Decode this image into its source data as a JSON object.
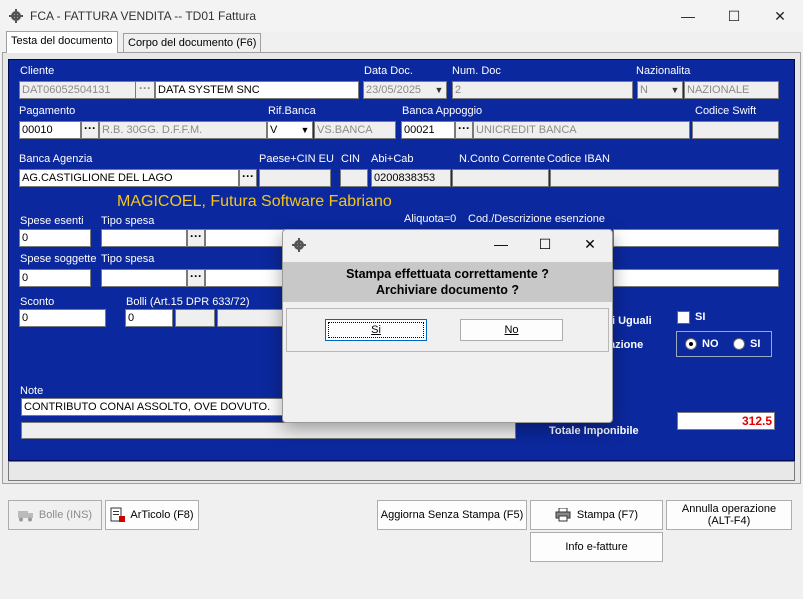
{
  "window": {
    "title": "FCA - FATTURA VENDITA  --  TD01 Fattura",
    "minimize": "—",
    "maximize": "☐",
    "close": "✕"
  },
  "tabs": [
    {
      "label": "Testa del documento"
    },
    {
      "label": "Corpo del documento (F6)"
    }
  ],
  "header": {
    "cliente_label": "Cliente",
    "cliente_code": "DAT06052504131",
    "cliente_name": "DATA SYSTEM SNC",
    "data_doc_label": "Data Doc.",
    "data_doc": "23/05/2025",
    "num_doc_label": "Num. Doc",
    "num_doc": "2",
    "nazionalita_label": "Nazionalita",
    "nazionalita_code": "N",
    "nazionalita_name": "NAZIONALE"
  },
  "pagamento": {
    "label": "Pagamento",
    "code": "00010",
    "desc": "R.B. 30GG. D.F.F.M.",
    "rif_banca_label": "Rif.Banca",
    "rif_banca_code": "V",
    "rif_banca_desc": "VS.BANCA",
    "banca_appoggio_label": "Banca Appoggio",
    "banca_appoggio_code": "00021",
    "banca_appoggio_name": "UNICREDIT BANCA",
    "codice_swift_label": "Codice Swift"
  },
  "banca_agenzia": {
    "label": "Banca Agenzia",
    "value": "AG.CASTIGLIONE DEL LAGO",
    "paese_cin_label": "Paese+CIN EU",
    "cin_label": "CIN",
    "abi_cab_label": "Abi+Cab",
    "abi_cab": "0200838353",
    "n_conto_label": "N.Conto Corrente",
    "iban_label": "Codice IBAN"
  },
  "brand": "MAGICOEL, Futura Software Fabriano",
  "spese": {
    "esenti_label": "Spese esenti",
    "esenti_value": "0",
    "tipo_spesa_label": "Tipo spesa",
    "aliquota_label": "Aliquota=0",
    "cod_desc_label": "Cod./Descrizione esenzione",
    "soggette_label": "Spese soggette",
    "soggette_value": "0",
    "tipo_spesa2_label": "Tipo spesa"
  },
  "sconto": {
    "label": "Sconto",
    "value": "0",
    "bolli_label": "Bolli (Art.15 DPR 633/72)",
    "bolli_value": "0"
  },
  "options": {
    "uguali_label": "i Uguali",
    "si_label": "SI",
    "azione_label": "azione",
    "no_radio": "NO",
    "si_radio": "SI"
  },
  "note": {
    "label": "Note",
    "value": "CONTRIBUTO CONAI ASSOLTO, OVE DOVUTO."
  },
  "totale": {
    "label": "Totale Imponibile",
    "value": "312.5",
    "value_color": "#e00000"
  },
  "buttons": {
    "bolle": "Bolle  (INS)",
    "articolo": "ArTicolo (F8)",
    "aggiorna": "Aggiorna Senza Stampa (F5)",
    "stampa": "Stampa  (F7)",
    "annulla_line1": "Annulla operazione",
    "annulla_line2": "(ALT-F4)",
    "info": "Info e-fatture"
  },
  "dialog": {
    "message_line1": "Stampa effettuata correttamente ?",
    "message_line2": "Archiviare documento ?",
    "yes": "Si",
    "no": "No"
  },
  "colors": {
    "panel_blue": "#0b289e",
    "brand_yellow": "#f5c518"
  }
}
